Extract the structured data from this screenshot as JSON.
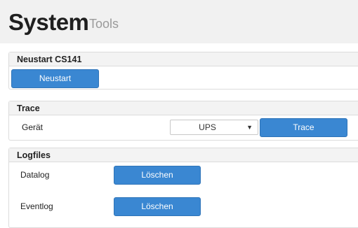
{
  "header": {
    "title": "System",
    "subtitle": "Tools"
  },
  "restart_panel": {
    "title": "Neustart CS141",
    "button_label": "Neustart"
  },
  "trace_panel": {
    "title": "Trace",
    "device_label": "Gerät",
    "device_select": {
      "value": "UPS",
      "caret_icon": "chevron-down-icon"
    },
    "button_label": "Trace"
  },
  "logfiles_panel": {
    "title": "Logfiles",
    "rows": [
      {
        "label": "Datalog",
        "button_label": "Löschen"
      },
      {
        "label": "Eventlog",
        "button_label": "Löschen"
      }
    ]
  },
  "colors": {
    "accent": "#3a87d2",
    "header_bg": "#f1f1f1",
    "panel_head_bg": "#f3f3f3"
  }
}
